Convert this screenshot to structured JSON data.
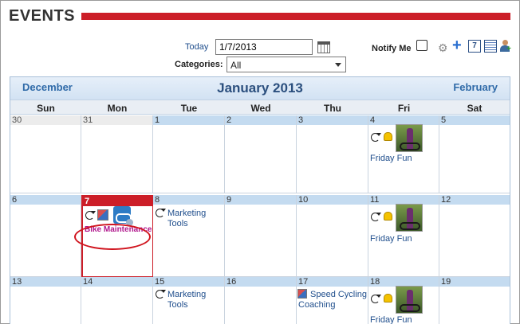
{
  "header": {
    "title": "EVENTS"
  },
  "toolbar": {
    "today_label": "Today",
    "date_value": "1/7/2013",
    "categories_label": "Categories:",
    "categories_value": "All",
    "notify_label": "Notify Me",
    "icons": [
      "calendar-picker-icon",
      "gear-icon",
      "add-event-icon",
      "day-view-icon",
      "list-view-icon",
      "add-user-icon"
    ]
  },
  "calendar": {
    "prev_month": "December",
    "current_month": "January 2013",
    "next_month": "February",
    "weekdays": [
      "Sun",
      "Mon",
      "Tue",
      "Wed",
      "Thu",
      "Fri",
      "Sat"
    ],
    "weeks": [
      [
        "30",
        "31",
        "1",
        "2",
        "3",
        "4",
        "5"
      ],
      [
        "6",
        "7",
        "8",
        "9",
        "10",
        "11",
        "12"
      ],
      [
        "13",
        "14",
        "15",
        "16",
        "17",
        "18",
        "19"
      ]
    ],
    "events": {
      "friday_fun": "Friday Fun",
      "bike_maintenance": "Bike Maintenance",
      "marketing_tools": "Marketing Tools",
      "speed_cycling": "Speed Cycling Coaching"
    }
  },
  "colors": {
    "accent": "#cc1e28",
    "link": "#1f4e8c",
    "highlight_event": "#b0168c",
    "day_header": "#c4dbf0"
  }
}
